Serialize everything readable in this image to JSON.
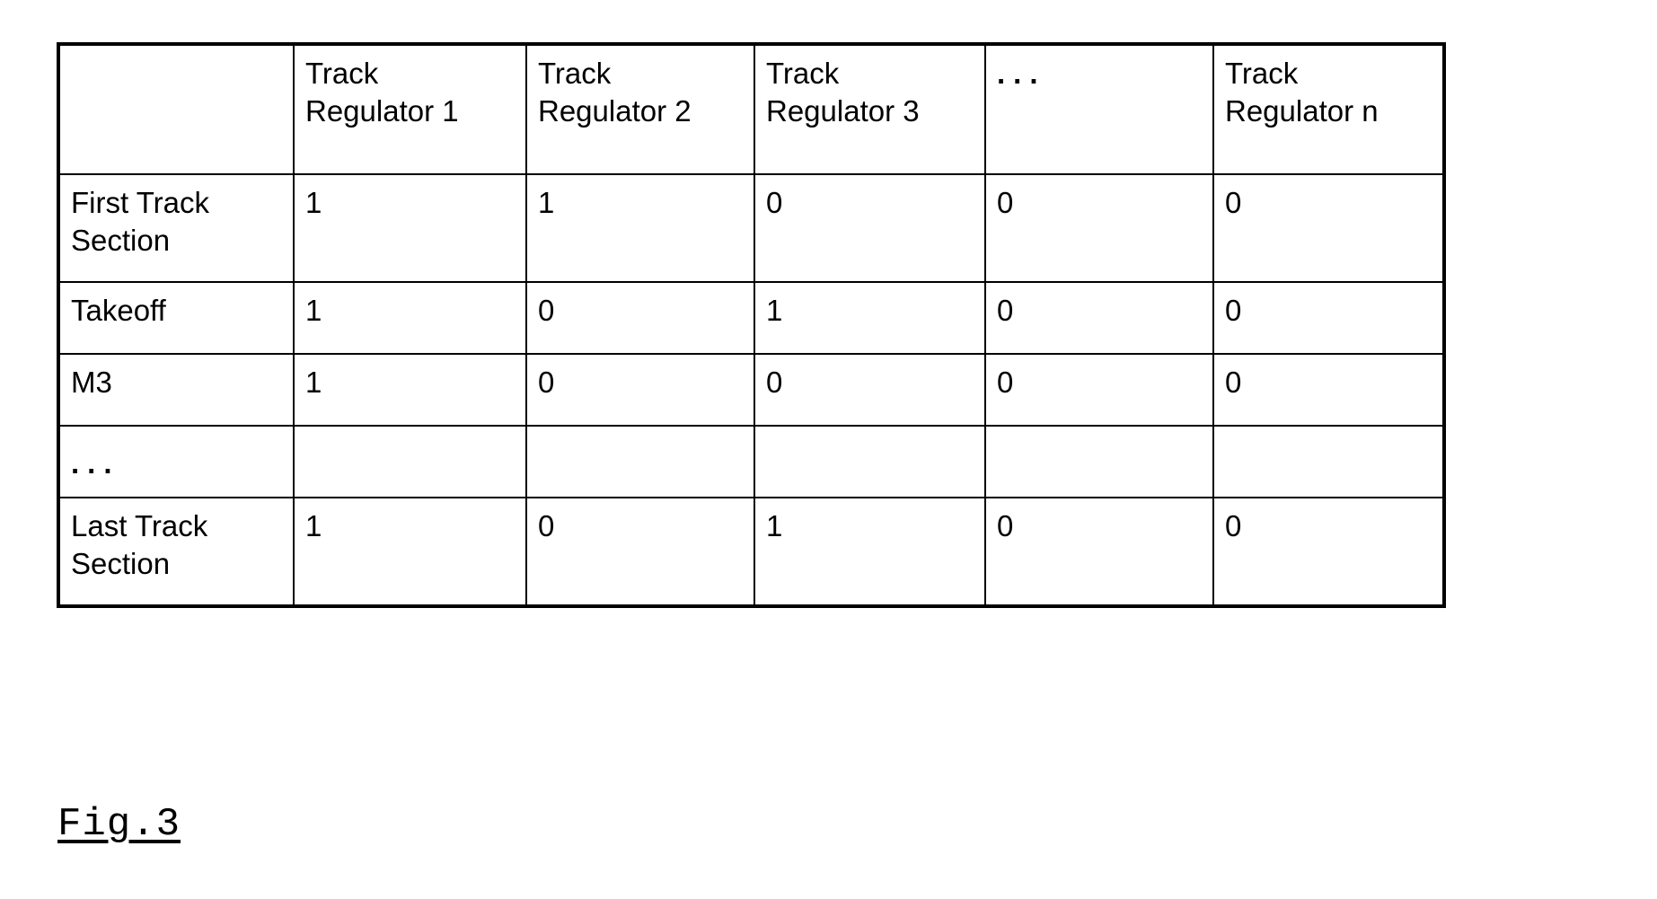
{
  "figure": {
    "caption": "Fig.3",
    "background_color": "#ffffff",
    "line_color": "#000000",
    "text_color": "#000000"
  },
  "table": {
    "corner_label": "",
    "columns": [
      {
        "key": "label",
        "header": ""
      },
      {
        "key": "r1",
        "header": "Track\nRegulator 1"
      },
      {
        "key": "r2",
        "header": "Track\nRegulator 2"
      },
      {
        "key": "r3",
        "header": "Track\nRegulator 3"
      },
      {
        "key": "dots",
        "header": "..."
      },
      {
        "key": "rn",
        "header": "Track\nRegulator n"
      }
    ],
    "rows": [
      {
        "label": "First Track\nSection",
        "values": [
          "1",
          "1",
          "0",
          "0",
          "0"
        ]
      },
      {
        "label": "Takeoff",
        "values": [
          "1",
          "0",
          "1",
          "0",
          "0"
        ]
      },
      {
        "label": "M3",
        "values": [
          "1",
          "0",
          "0",
          "0",
          "0"
        ]
      },
      {
        "label": "...",
        "values": [
          "",
          "",
          "",
          "",
          ""
        ]
      },
      {
        "label": "Last Track\nSection",
        "values": [
          "1",
          "0",
          "1",
          "0",
          "0"
        ]
      }
    ]
  }
}
